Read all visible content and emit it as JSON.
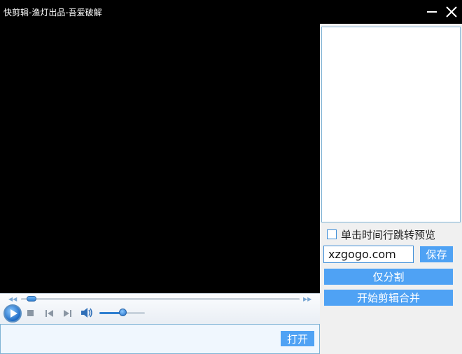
{
  "window": {
    "title": "快剪辑-渔灯出品-吾爱破解",
    "minimize_icon": "minimize-icon",
    "close_icon": "close-icon"
  },
  "player": {
    "seek_progress": 0.02,
    "volume_level": 0.5,
    "icons": [
      "play-icon",
      "stop-icon",
      "previous-icon",
      "next-icon",
      "volume-icon"
    ]
  },
  "open_button": {
    "label": "打开"
  },
  "side_panel": {
    "checkbox_label": "单击时间行跳转预览",
    "checkbox_checked": false,
    "input_value": "xzgogo.com",
    "save_label": "保存",
    "split_label": "仅分割",
    "merge_label": "开始剪辑合并"
  },
  "colors": {
    "accent": "#4fa2f4",
    "border": "#7fb3d5",
    "panel_bg": "#f0f0f0"
  }
}
